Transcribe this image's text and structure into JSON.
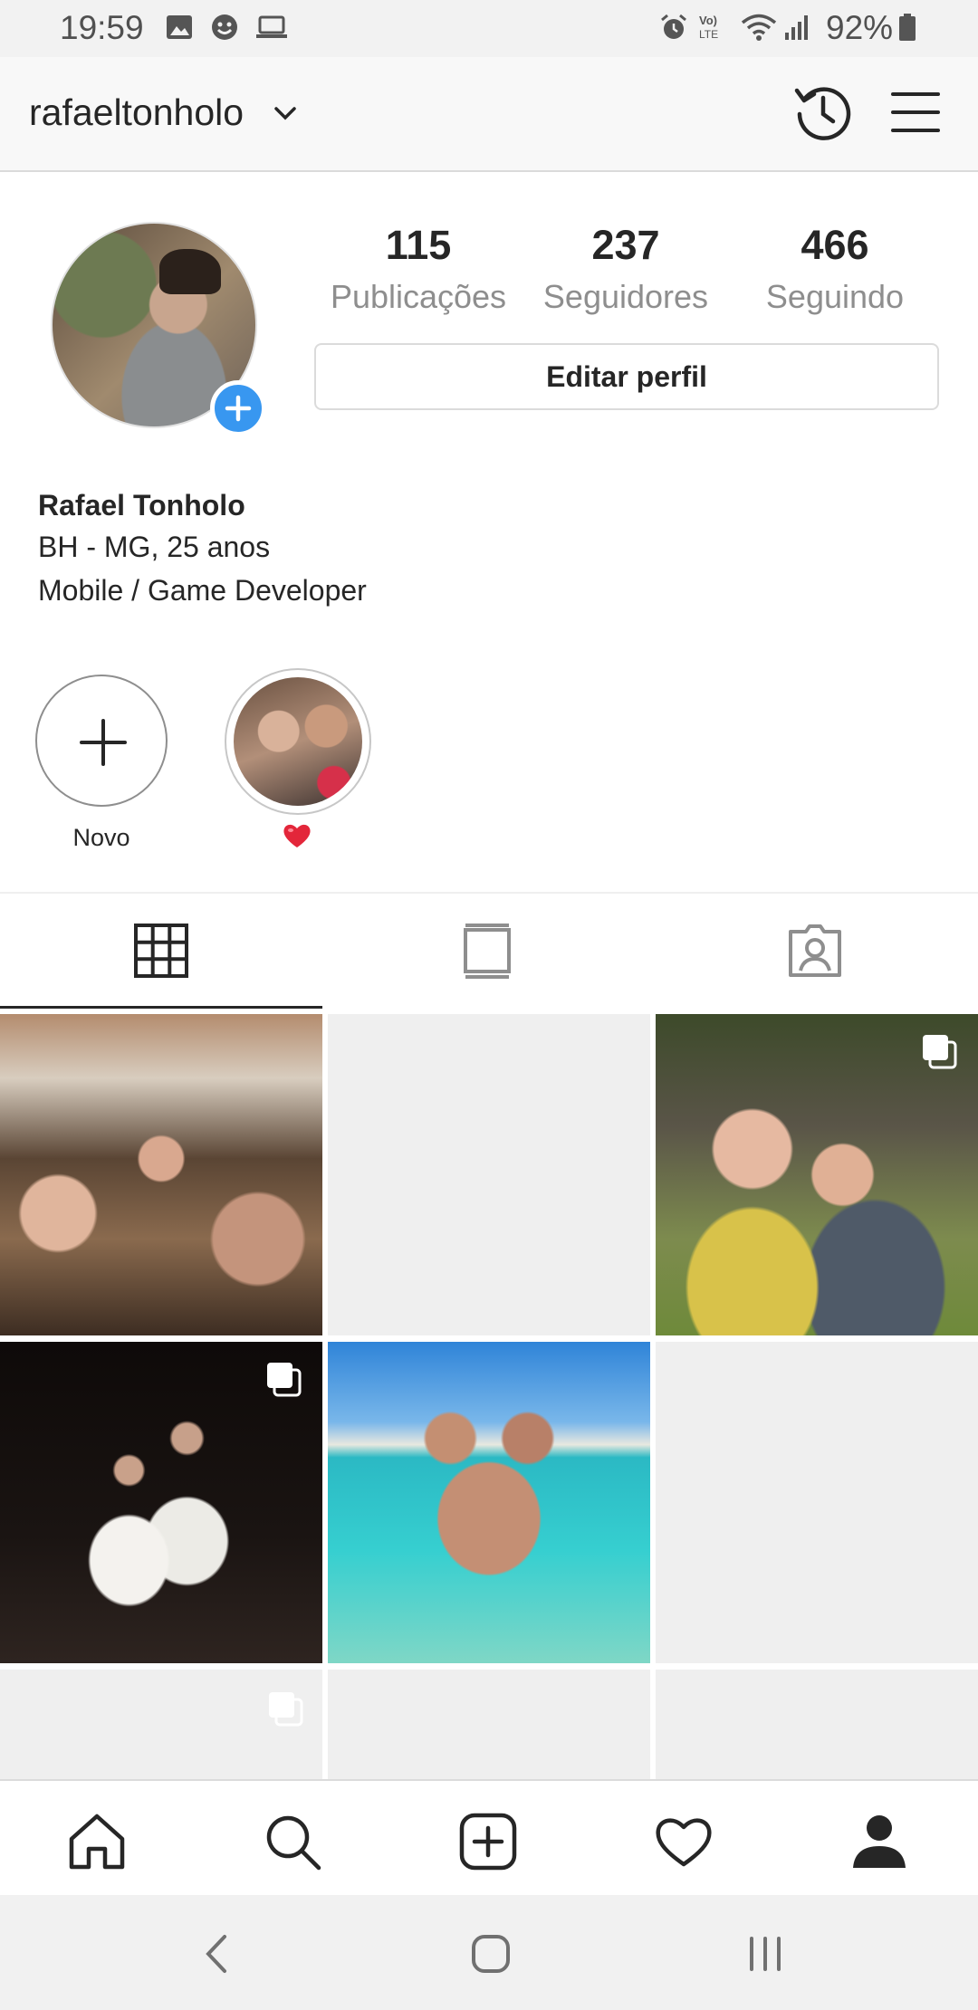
{
  "status_bar": {
    "time": "19:59",
    "battery_percent": "92%",
    "left_icons": [
      "gallery-icon",
      "emoji-icon",
      "laptop-icon"
    ],
    "right_icons": [
      "alarm-icon",
      "volte-icon",
      "wifi-icon",
      "signal-icon",
      "battery-icon"
    ]
  },
  "header": {
    "username": "rafaeltonholo",
    "icons": [
      "chevron-down-icon",
      "history-icon",
      "menu-icon"
    ]
  },
  "profile": {
    "stats": [
      {
        "value": "115",
        "label": "Publicações"
      },
      {
        "value": "237",
        "label": "Seguidores"
      },
      {
        "value": "466",
        "label": "Seguindo"
      }
    ],
    "edit_button": "Editar perfil",
    "full_name": "Rafael Tonholo",
    "bio": [
      "BH - MG, 25 anos",
      "Mobile / Game Developer"
    ]
  },
  "highlights": [
    {
      "label": "Novo",
      "icon": "plus-icon"
    },
    {
      "label": "heart-emoji",
      "icon": "heart-emoji-icon"
    }
  ],
  "tabs": [
    {
      "name": "grid",
      "icon": "grid-icon",
      "active": true
    },
    {
      "name": "feed",
      "icon": "feed-icon",
      "active": false
    },
    {
      "name": "tagged",
      "icon": "tagged-user-icon",
      "active": false
    }
  ],
  "colors": {
    "accent_blue": "#3897f0",
    "text": "#262626",
    "secondary_text": "#8e8e8e",
    "border": "#dbdbdb",
    "placeholder": "#efefef"
  },
  "bottom_nav": [
    "home-icon",
    "search-icon",
    "new-post-icon",
    "activity-heart-icon",
    "profile-icon"
  ],
  "system_nav": [
    "back-icon",
    "home-circle-icon",
    "recent-apps-icon"
  ]
}
